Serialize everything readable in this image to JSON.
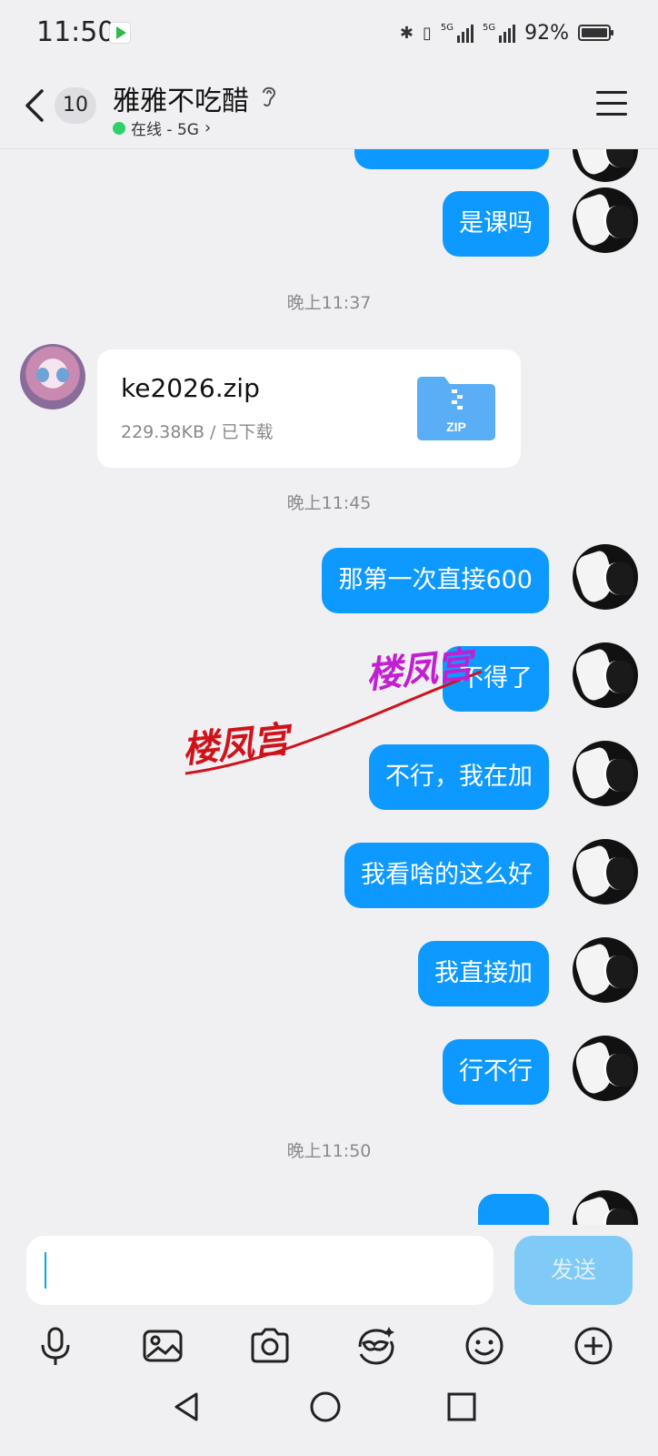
{
  "status_bar": {
    "time": "11:50",
    "battery_percent": "92%",
    "signal_label_1": "5G",
    "signal_label_2": "5G"
  },
  "header": {
    "unread_count": "10",
    "contact_name": "雅雅不吃醋",
    "status_text": "在线 - 5G"
  },
  "messages": [
    {
      "type": "text",
      "from": "me",
      "text": "是课吗"
    },
    {
      "type": "time",
      "text": "晚上11:37"
    },
    {
      "type": "file",
      "from": "her",
      "file_name": "ke2026.zip",
      "file_meta": "229.38KB / 已下载",
      "icon_label": "ZIP"
    },
    {
      "type": "time",
      "text": "晚上11:45"
    },
    {
      "type": "text",
      "from": "me",
      "text": "那第一次直接600"
    },
    {
      "type": "text",
      "from": "me",
      "text": "不得了"
    },
    {
      "type": "text",
      "from": "me",
      "text": "不行，我在加"
    },
    {
      "type": "text",
      "from": "me",
      "text": "我看啥的这么好"
    },
    {
      "type": "text",
      "from": "me",
      "text": "我直接加"
    },
    {
      "type": "text",
      "from": "me",
      "text": "行不行"
    },
    {
      "type": "time",
      "text": "晚上11:50"
    }
  ],
  "watermark": {
    "text_1": "楼凤宫",
    "text_2": "楼凤宫"
  },
  "input": {
    "send_label": "发送"
  },
  "toolbar_icons": [
    "microphone-icon",
    "image-icon",
    "camera-icon",
    "sticker-icon",
    "emoji-icon",
    "plus-icon"
  ],
  "colors": {
    "bubble": "#0d99ff",
    "background": "#f0f0f2",
    "send_disabled": "#7fcaf7",
    "online": "#2ed16b"
  }
}
